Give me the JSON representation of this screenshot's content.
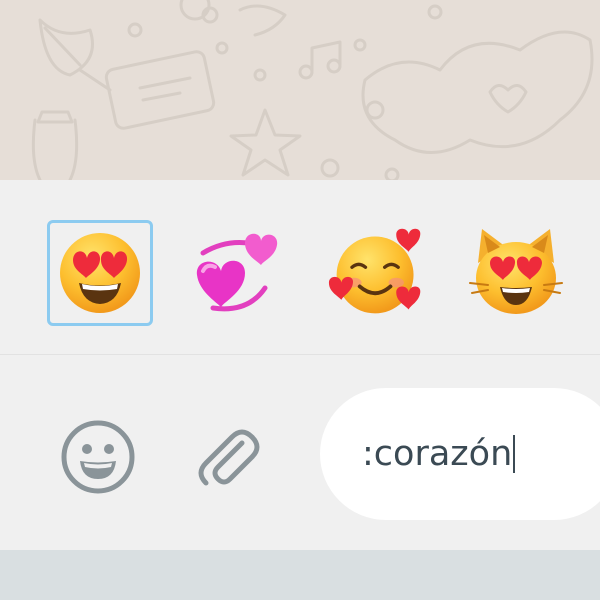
{
  "chat": {
    "background_color": "#e6ded7",
    "doodle_color": "#d6cec6"
  },
  "emoji_suggestions": {
    "items": [
      {
        "name": "smiling-face-with-heart-eyes",
        "selected": true
      },
      {
        "name": "revolving-hearts",
        "selected": false
      },
      {
        "name": "smiling-face-with-hearts",
        "selected": false
      },
      {
        "name": "smiling-cat-with-heart-eyes",
        "selected": false
      }
    ],
    "selection_border_color": "#8ccbf0"
  },
  "compose": {
    "emoji_button_icon": "smiley-icon",
    "attach_button_icon": "paperclip-icon",
    "input_value": ":corazón",
    "icon_color": "#8a9499"
  }
}
